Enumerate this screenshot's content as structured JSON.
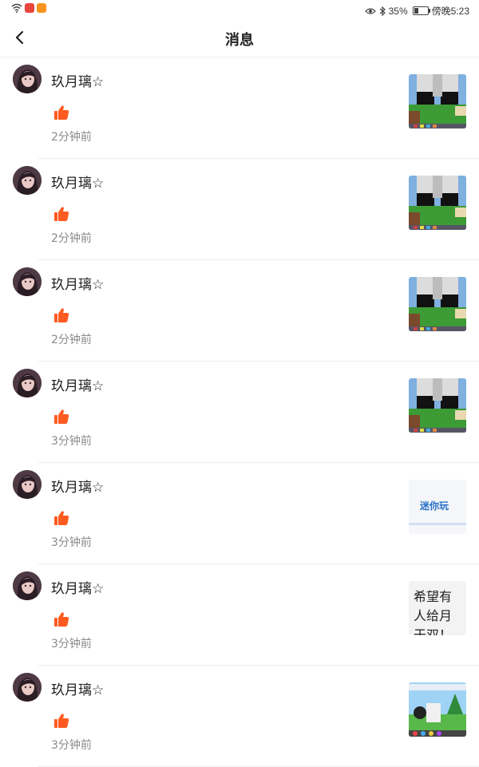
{
  "status_bar": {
    "battery": "35%",
    "battery_level": 0.35,
    "time": "傍晚5:23",
    "icons": [
      "wifi-icon",
      "app-icon-red",
      "app-icon-orange",
      "eye-icon",
      "bluetooth-icon",
      "battery-icon"
    ]
  },
  "header": {
    "title": "消息",
    "back_icon": "chevron-left-icon"
  },
  "colors": {
    "like": "#ff5a1f",
    "text": "#222222",
    "muted": "#8a8a8a",
    "divider": "#eeeeee"
  },
  "messages": [
    {
      "name": "玖月璃☆",
      "action_icon": "thumbs-up-icon",
      "time": "2分钟前",
      "thumb": "game-screenshot"
    },
    {
      "name": "玖月璃☆",
      "action_icon": "thumbs-up-icon",
      "time": "2分钟前",
      "thumb": "game-screenshot"
    },
    {
      "name": "玖月璃☆",
      "action_icon": "thumbs-up-icon",
      "time": "2分钟前",
      "thumb": "game-screenshot"
    },
    {
      "name": "玖月璃☆",
      "action_icon": "thumbs-up-icon",
      "time": "3分钟前",
      "thumb": "game-screenshot"
    },
    {
      "name": "玖月璃☆",
      "action_icon": "thumbs-up-icon",
      "time": "3分钟前",
      "thumb": "logo-image",
      "thumb_label": "迷你玩"
    },
    {
      "name": "玖月璃☆",
      "action_icon": "thumbs-up-icon",
      "time": "3分钟前",
      "thumb": "text-post",
      "thumb_text": "希望有人给月于双！"
    },
    {
      "name": "玖月璃☆",
      "action_icon": "thumbs-up-icon",
      "time": "3分钟前",
      "thumb": "game-screenshot-2"
    }
  ]
}
